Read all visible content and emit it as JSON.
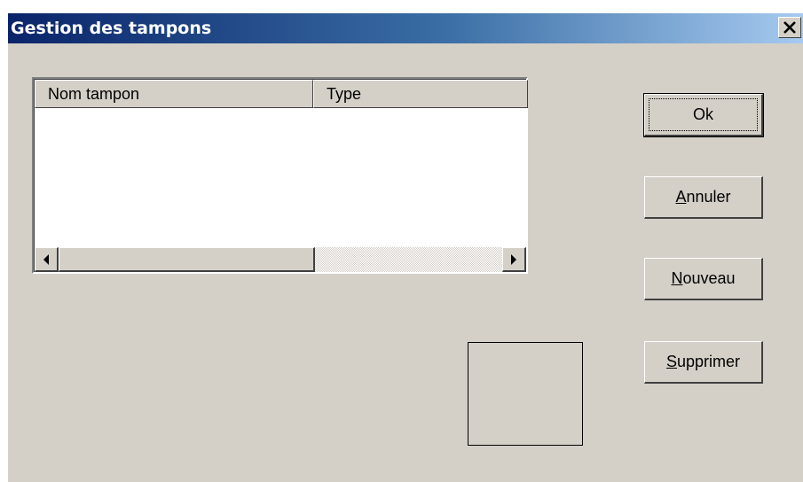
{
  "window": {
    "title": "Gestion des tampons",
    "close_icon": "close-icon"
  },
  "list": {
    "columns": [
      "Nom tampon",
      "Type"
    ],
    "rows": [],
    "scroll_left_icon": "triangle-left-icon",
    "scroll_right_icon": "triangle-right-icon"
  },
  "buttons": {
    "ok": "Ok",
    "annuler": {
      "mnemonic": "A",
      "rest": "nnuler"
    },
    "nouveau": {
      "mnemonic": "N",
      "rest": "ouveau"
    },
    "supprimer": {
      "mnemonic": "S",
      "rest": "upprimer"
    }
  },
  "colors": {
    "title_start": "#0a246a",
    "title_end": "#a6caf0",
    "face": "#d4d0c8"
  }
}
